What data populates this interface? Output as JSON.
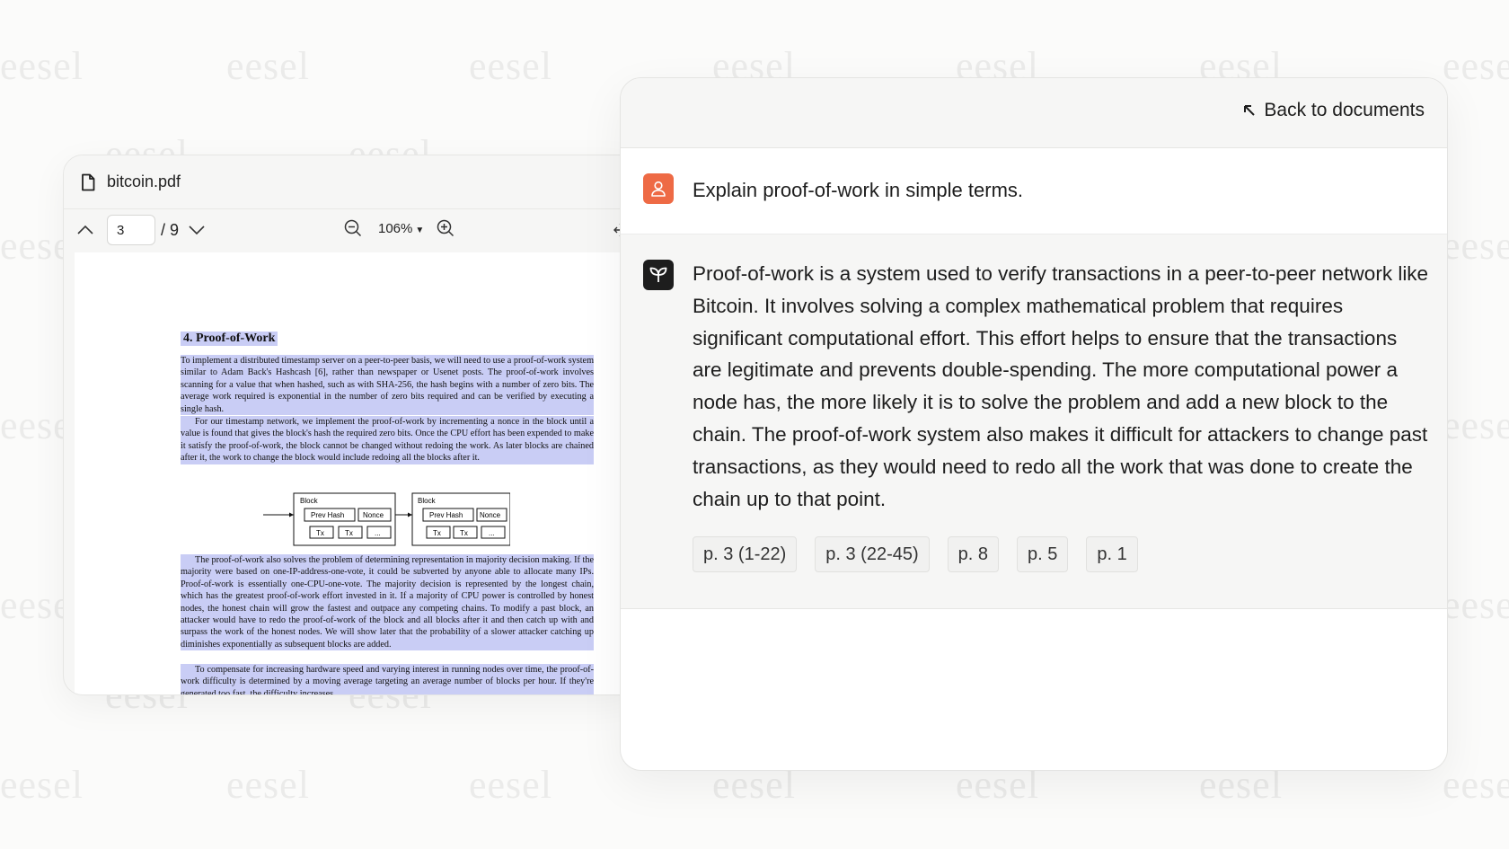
{
  "watermark": {
    "text": "eesel"
  },
  "pdf_viewer": {
    "file_name": "bitcoin.pdf",
    "current_page": "3",
    "total_pages": "/ 9",
    "zoom": "106%",
    "page_content": {
      "section_title": "4.   Proof-of-Work",
      "paragraph_1": "To implement a distributed timestamp server on a peer-to-peer basis, we will need to use a proof-of-work system similar to Adam Back's Hashcash [6], rather than newspaper or Usenet posts. The proof-of-work involves scanning for a value that when hashed, such as with SHA-256, the hash begins with a number of zero bits. The average work required is exponential in the number of zero bits required and can be verified by executing a single hash.",
      "paragraph_2": "For our timestamp network, we implement the proof-of-work by incrementing a nonce in the block until a value is found that gives the block's hash the required zero bits. Once the CPU effort has been expended to make it satisfy the proof-of-work, the block cannot be changed without redoing the work. As later blocks are chained after it, the work to change the block would include redoing all the blocks after it.",
      "diagram": {
        "block_label": "Block",
        "prev_hash": "Prev Hash",
        "nonce": "Nonce",
        "tx": "Tx",
        "ellipsis": "..."
      },
      "paragraph_3": "The proof-of-work also solves the problem of determining representation in majority decision making. If the majority were based on one-IP-address-one-vote, it could be subverted by anyone able to allocate many IPs. Proof-of-work is essentially one-CPU-one-vote. The majority decision is represented by the longest chain, which has the greatest proof-of-work effort invested in it. If a majority of CPU power is controlled by honest nodes, the honest chain will grow the fastest and outpace any competing chains. To modify a past block, an attacker would have to redo the proof-of-work of the block and all blocks after it and then catch up with and surpass the work of the honest nodes. We will show later that the probability of a slower attacker catching up diminishes exponentially as subsequent blocks are added.",
      "paragraph_4": "To compensate for increasing hardware speed and varying interest in running nodes over time, the proof-of-work difficulty is determined by a moving average targeting an average number of blocks per hour. If they're generated too fast, the difficulty increases."
    }
  },
  "chat": {
    "back_label": "Back to documents",
    "user_message": "Explain proof-of-work in simple terms.",
    "assistant_message": "Proof-of-work is a system used to verify transactions in a peer-to-peer network like Bitcoin. It involves solving a complex mathematical problem that requires significant computational effort. This effort helps to ensure that the transactions are legitimate and prevents double-spending. The more computational power a node has, the more likely it is to solve the problem and add a new block to the chain. The proof-of-work system also makes it difficult for attackers to change past transactions, as they would need to redo all the work that was done to create the chain up to that point.",
    "citations": [
      "p. 3 (1-22)",
      "p. 3 (22-45)",
      "p. 8",
      "p. 5",
      "p. 1"
    ]
  },
  "colors": {
    "user_avatar": "#ee6a45",
    "bot_avatar": "#1d1d1d",
    "highlight": "#c9cdf5"
  }
}
